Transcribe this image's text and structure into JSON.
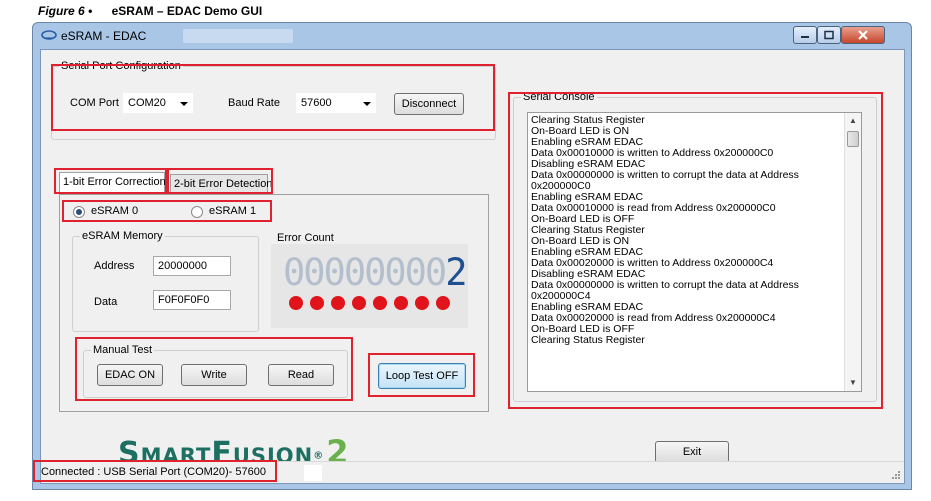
{
  "caption": {
    "figure": "Figure 6 •",
    "title": "eSRAM – EDAC Demo GUI"
  },
  "window": {
    "title": "eSRAM - EDAC"
  },
  "serial_port_config": {
    "title": "Serial Port Configuration",
    "com_port_label": "COM Port",
    "com_port_value": "COM20",
    "baud_rate_label": "Baud Rate",
    "baud_rate_value": "57600",
    "disconnect_label": "Disconnect"
  },
  "tabs": {
    "tab1": "1-bit Error Correction",
    "tab2": "2-bit Error Detection"
  },
  "esram_select": {
    "option0": "eSRAM 0",
    "option1": "eSRAM 1",
    "selected": "eSRAM 0"
  },
  "esram_memory": {
    "title": "eSRAM Memory",
    "address_label": "Address",
    "address_value": "20000000",
    "data_label": "Data",
    "data_value": "F0F0F0F0"
  },
  "error_count": {
    "title": "Error Count",
    "digits_dim": "00000000",
    "digits_lit": "2",
    "led_count": 8,
    "led_color": "#e0141a",
    "digit_color": "#1d4f91"
  },
  "manual_test": {
    "title": "Manual Test",
    "edac_on": "EDAC ON",
    "write": "Write",
    "read": "Read"
  },
  "loop_test": {
    "label": "Loop Test OFF"
  },
  "serial_console": {
    "title": "Serial Console",
    "lines": [
      "Clearing Status Register",
      "On-Board LED is ON",
      "Enabling eSRAM EDAC",
      "Data 0x00010000 is written to Address 0x200000C0",
      "Disabling eSRAM EDAC",
      "Data 0x00000000 is written to corrupt the data at Address",
      "0x200000C0",
      "Enabling eSRAM EDAC",
      "Data 0x00010000 is read from Address 0x200000C0",
      "On-Board LED is OFF",
      "Clearing Status Register",
      "On-Board LED is ON",
      "Enabling eSRAM EDAC",
      "Data 0x00020000 is written to Address 0x200000C4",
      "Disabling eSRAM EDAC",
      "Data 0x00000000 is written to corrupt the data at Address",
      "0x200000C4",
      "Enabling eSRAM EDAC",
      "Data 0x00020000 is read from Address 0x200000C4",
      "On-Board LED is OFF",
      "Clearing Status Register"
    ]
  },
  "logo": {
    "s": "S",
    "mart": "MART",
    "f": "F",
    "usion": "USION",
    "reg": "®",
    "two": "2",
    "color": "#1d6f62",
    "accent": "#6ab04c"
  },
  "exit": {
    "label": "Exit"
  },
  "status_bar": {
    "text": "Connected : USB Serial Port (COM20)- 57600"
  },
  "highlight_color": "#e0222e"
}
